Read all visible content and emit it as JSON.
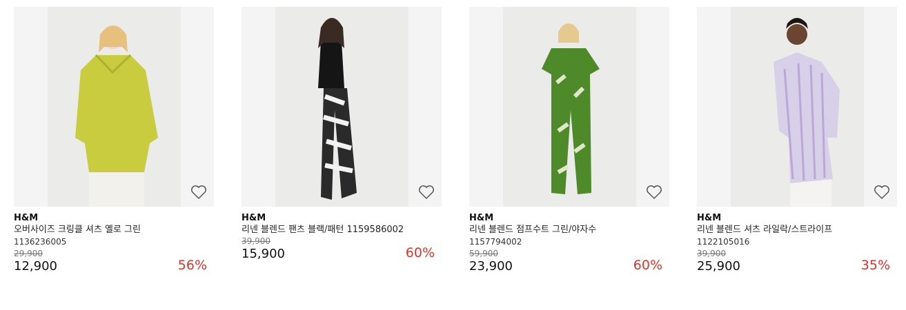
{
  "products": [
    {
      "brand": "H&M",
      "name": "오버사이즈 크링클 셔츠 옐로 그린",
      "code": "1136236005",
      "old_price": "29,900",
      "price": "12,900",
      "discount": "56%"
    },
    {
      "brand": "H&M",
      "name": "리넨 블렌드 팬츠 블랙/패턴 1159586002",
      "code": "",
      "old_price": "39,900",
      "price": "15,900",
      "discount": "60%"
    },
    {
      "brand": "H&M",
      "name": "리넨 블렌드 점프수트 그린/야자수",
      "code": "1157794002",
      "old_price": "59,900",
      "price": "23,900",
      "discount": "60%"
    },
    {
      "brand": "H&M",
      "name": "리넨 블렌드 셔츠 라일락/스트라이프",
      "code": "1122105016",
      "old_price": "39,900",
      "price": "25,900",
      "discount": "35%"
    }
  ],
  "colors": {
    "discount": "#e2322b",
    "image_bg": "#f4f4f4"
  },
  "icons": {
    "wishlist": "heart-outline-icon"
  }
}
